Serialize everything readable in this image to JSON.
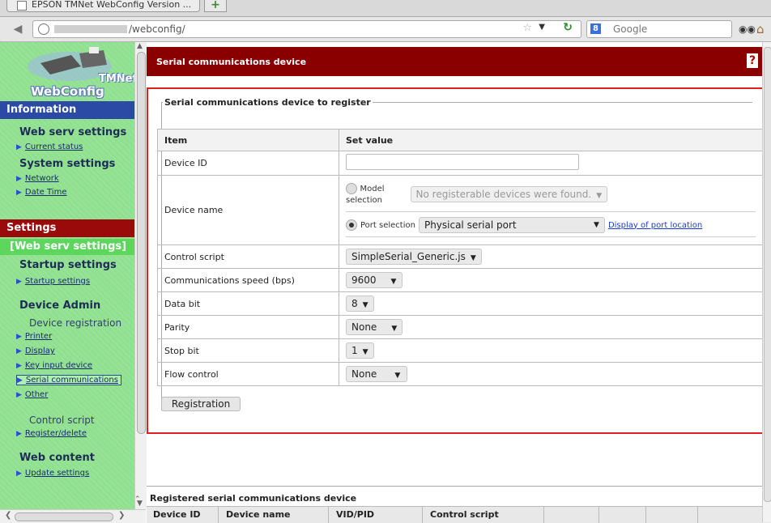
{
  "browser": {
    "tab_title": "EPSON TMNet WebConfig Version ...",
    "url": "/webconfig/",
    "search_placeholder": "Google",
    "search_engine": "8"
  },
  "sidebar": {
    "logo_line1": "TMNet",
    "logo_line2": "WebConfig",
    "information_header": "Information",
    "web_serv_settings": "Web serv settings",
    "current_status": "Current status",
    "system_settings": "System settings",
    "network": "Network",
    "date_time": "Date Time",
    "settings_header": "Settings",
    "current_section": "[Web serv settings]",
    "startup_settings_head": "Startup settings",
    "startup_settings_link": "Startup settings",
    "device_admin": "Device Admin",
    "device_registration": "Device registration",
    "printer": "Printer",
    "display": "Display",
    "key_input_device": "Key input device",
    "serial_communications": "Serial communications",
    "other": "Other",
    "control_script": "Control script",
    "register_delete": "Register/delete",
    "web_content": "Web content",
    "update_settings": "Update settings"
  },
  "main": {
    "header_title": "Serial communications device",
    "help_icon": "?",
    "fieldset_legend": "Serial communications device to register",
    "table_head": {
      "item": "Item",
      "set_value": "Set value"
    },
    "rows": {
      "device_id": "Device ID",
      "device_name": "Device name",
      "model_selection_1": "Model",
      "model_selection_2": "selection",
      "model_dropdown": "No registerable devices were found.",
      "port_selection": "Port selection",
      "port_dropdown": "Physical serial port",
      "display_port_location": "Display of port location",
      "control_script": "Control script",
      "control_script_value": "SimpleSerial_Generic.js",
      "comm_speed": "Communications speed (bps)",
      "comm_speed_value": "9600",
      "data_bit": "Data bit",
      "data_bit_value": "8",
      "parity": "Parity",
      "parity_value": "None",
      "stop_bit": "Stop bit",
      "stop_bit_value": "1",
      "flow_control": "Flow control",
      "flow_control_value": "None"
    },
    "registration_button": "Registration",
    "registered_title": "Registered serial communications device",
    "registered_columns": [
      "Device ID",
      "Device name",
      "VID/PID",
      "Control script"
    ]
  },
  "colors": {
    "header_red": "#8a0000",
    "sidebar_green": "#8fe08f",
    "info_blue": "#2b4aa6",
    "settings_red": "#9b0a0a",
    "highlight_border": "#dd2222"
  }
}
